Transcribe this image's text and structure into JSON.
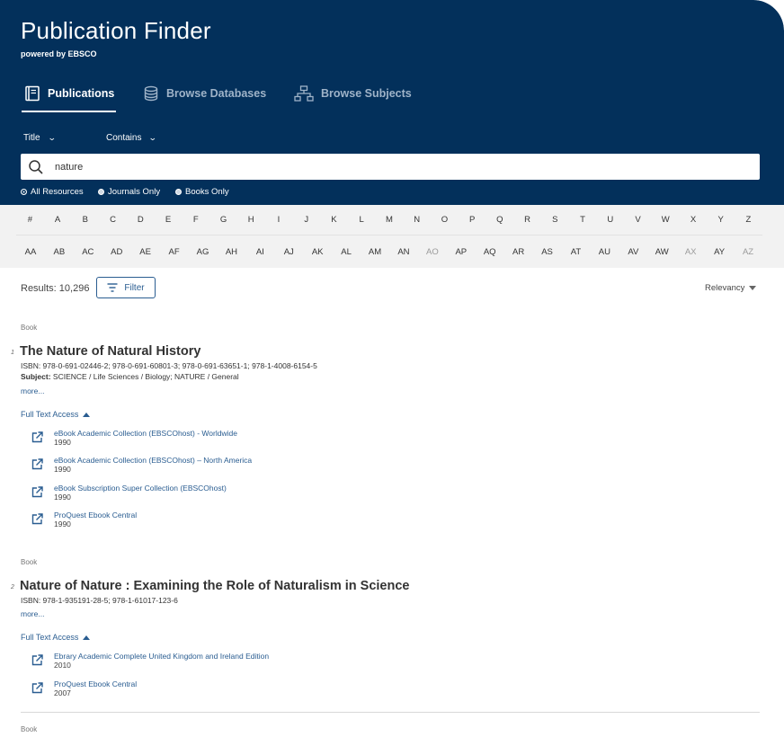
{
  "app": {
    "title": "Publication Finder",
    "powered_by": "powered by EBSCO"
  },
  "tabs": [
    {
      "label": "Publications",
      "icon": "book-icon",
      "active": true
    },
    {
      "label": "Browse Databases",
      "icon": "database-icon",
      "active": false
    },
    {
      "label": "Browse Subjects",
      "icon": "hierarchy-icon",
      "active": false
    }
  ],
  "search": {
    "field_select": "Title",
    "operator_select": "Contains",
    "query": "nature",
    "radios": [
      {
        "label": "All Resources",
        "selected": true
      },
      {
        "label": "Journals Only",
        "selected": false
      },
      {
        "label": "Books Only",
        "selected": false
      }
    ]
  },
  "alpha_row1": [
    "#",
    "A",
    "B",
    "C",
    "D",
    "E",
    "F",
    "G",
    "H",
    "I",
    "J",
    "K",
    "L",
    "M",
    "N",
    "O",
    "P",
    "Q",
    "R",
    "S",
    "T",
    "U",
    "V",
    "W",
    "X",
    "Y",
    "Z"
  ],
  "alpha_row2": [
    "AA",
    "AB",
    "AC",
    "AD",
    "AE",
    "AF",
    "AG",
    "AH",
    "AI",
    "AJ",
    "AK",
    "AL",
    "AM",
    "AN",
    "AO",
    "AP",
    "AQ",
    "AR",
    "AS",
    "AT",
    "AU",
    "AV",
    "AW",
    "AX",
    "AY",
    "AZ"
  ],
  "alpha_row2_disabled": [
    "AO",
    "AX",
    "AZ"
  ],
  "results": {
    "count_text": "Results: 10,296",
    "filter_label": "Filter",
    "sort_label": "Relevancy"
  },
  "records": [
    {
      "number": "1",
      "type": "Book",
      "title": "The Nature of Natural History",
      "isbn": "ISBN: 978-0-691-02446-2; 978-0-691-60801-3; 978-0-691-63651-1; 978-1-4008-6154-5",
      "subject_label": "Subject:",
      "subject": "SCIENCE / Life Sciences / Biology; NATURE / General",
      "more": "more...",
      "full_text_label": "Full Text Access",
      "links": [
        {
          "name": "eBook Academic Collection (EBSCOhost) - Worldwide",
          "year": "1990"
        },
        {
          "name": "eBook Academic Collection (EBSCOhost) – North America",
          "year": "1990"
        },
        {
          "name": "eBook Subscription Super Collection (EBSCOhost)",
          "year": "1990"
        },
        {
          "name": "ProQuest Ebook Central",
          "year": "1990"
        }
      ]
    },
    {
      "number": "2",
      "type": "Book",
      "title": "Nature of Nature : Examining the Role of Naturalism in Science",
      "isbn": "ISBN: 978-1-935191-28-5; 978-1-61017-123-6",
      "more": "more...",
      "full_text_label": "Full Text Access",
      "links": [
        {
          "name": "Ebrary Academic Complete United Kingdom and Ireland Edition",
          "year": "2010"
        },
        {
          "name": "ProQuest Ebook Central",
          "year": "2007"
        }
      ]
    },
    {
      "type": "Book"
    }
  ]
}
